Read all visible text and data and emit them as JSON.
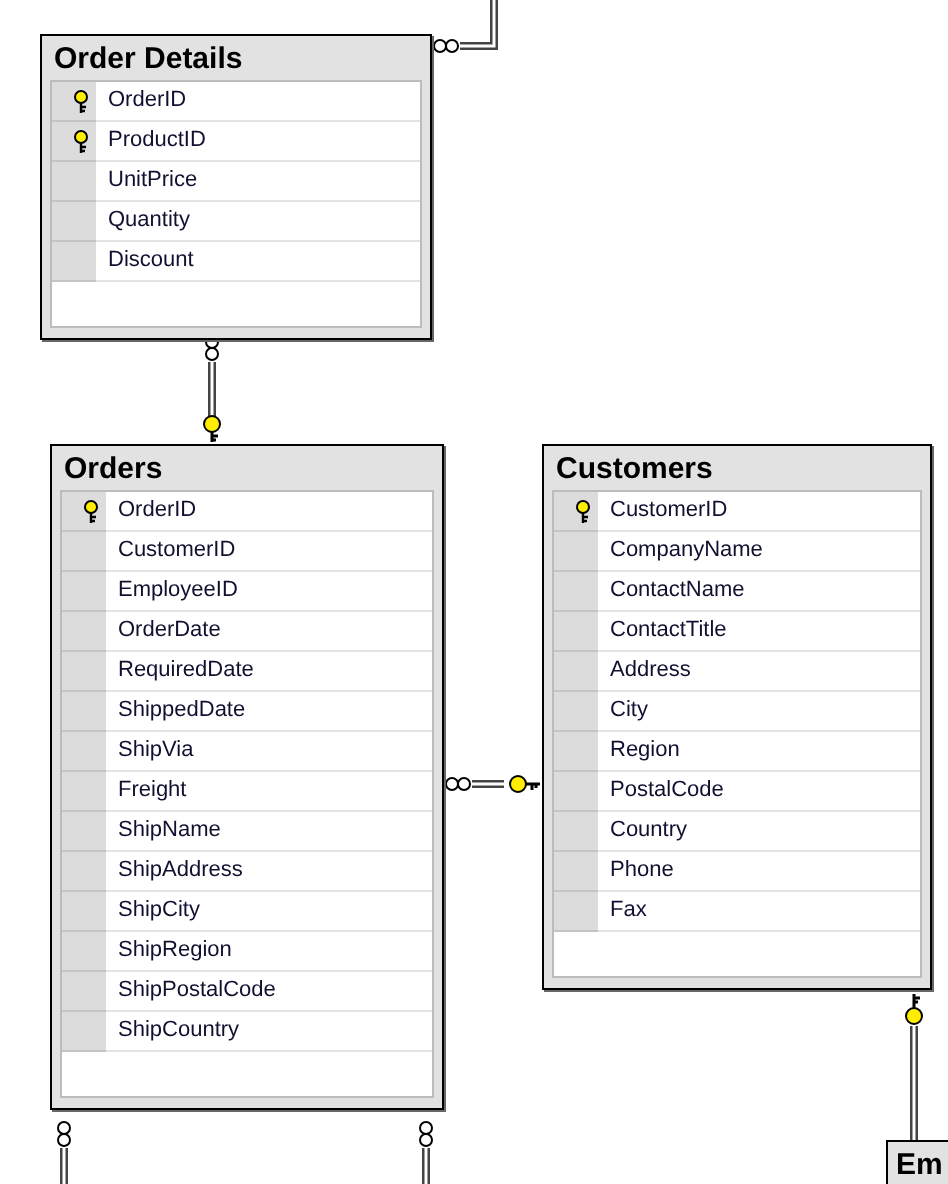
{
  "tables": [
    {
      "title": "Order Details",
      "fields": [
        {
          "name": "OrderID",
          "primary_key": true
        },
        {
          "name": "ProductID",
          "primary_key": true
        },
        {
          "name": "UnitPrice",
          "primary_key": false
        },
        {
          "name": "Quantity",
          "primary_key": false
        },
        {
          "name": "Discount",
          "primary_key": false
        }
      ]
    },
    {
      "title": "Orders",
      "fields": [
        {
          "name": "OrderID",
          "primary_key": true
        },
        {
          "name": "CustomerID",
          "primary_key": false
        },
        {
          "name": "EmployeeID",
          "primary_key": false
        },
        {
          "name": "OrderDate",
          "primary_key": false
        },
        {
          "name": "RequiredDate",
          "primary_key": false
        },
        {
          "name": "ShippedDate",
          "primary_key": false
        },
        {
          "name": "ShipVia",
          "primary_key": false
        },
        {
          "name": "Freight",
          "primary_key": false
        },
        {
          "name": "ShipName",
          "primary_key": false
        },
        {
          "name": "ShipAddress",
          "primary_key": false
        },
        {
          "name": "ShipCity",
          "primary_key": false
        },
        {
          "name": "ShipRegion",
          "primary_key": false
        },
        {
          "name": "ShipPostalCode",
          "primary_key": false
        },
        {
          "name": "ShipCountry",
          "primary_key": false
        }
      ]
    },
    {
      "title": "Customers",
      "fields": [
        {
          "name": "CustomerID",
          "primary_key": true
        },
        {
          "name": "CompanyName",
          "primary_key": false
        },
        {
          "name": "ContactName",
          "primary_key": false
        },
        {
          "name": "ContactTitle",
          "primary_key": false
        },
        {
          "name": "Address",
          "primary_key": false
        },
        {
          "name": "City",
          "primary_key": false
        },
        {
          "name": "Region",
          "primary_key": false
        },
        {
          "name": "PostalCode",
          "primary_key": false
        },
        {
          "name": "Country",
          "primary_key": false
        },
        {
          "name": "Phone",
          "primary_key": false
        },
        {
          "name": "Fax",
          "primary_key": false
        }
      ]
    },
    {
      "title": "Em"
    }
  ]
}
